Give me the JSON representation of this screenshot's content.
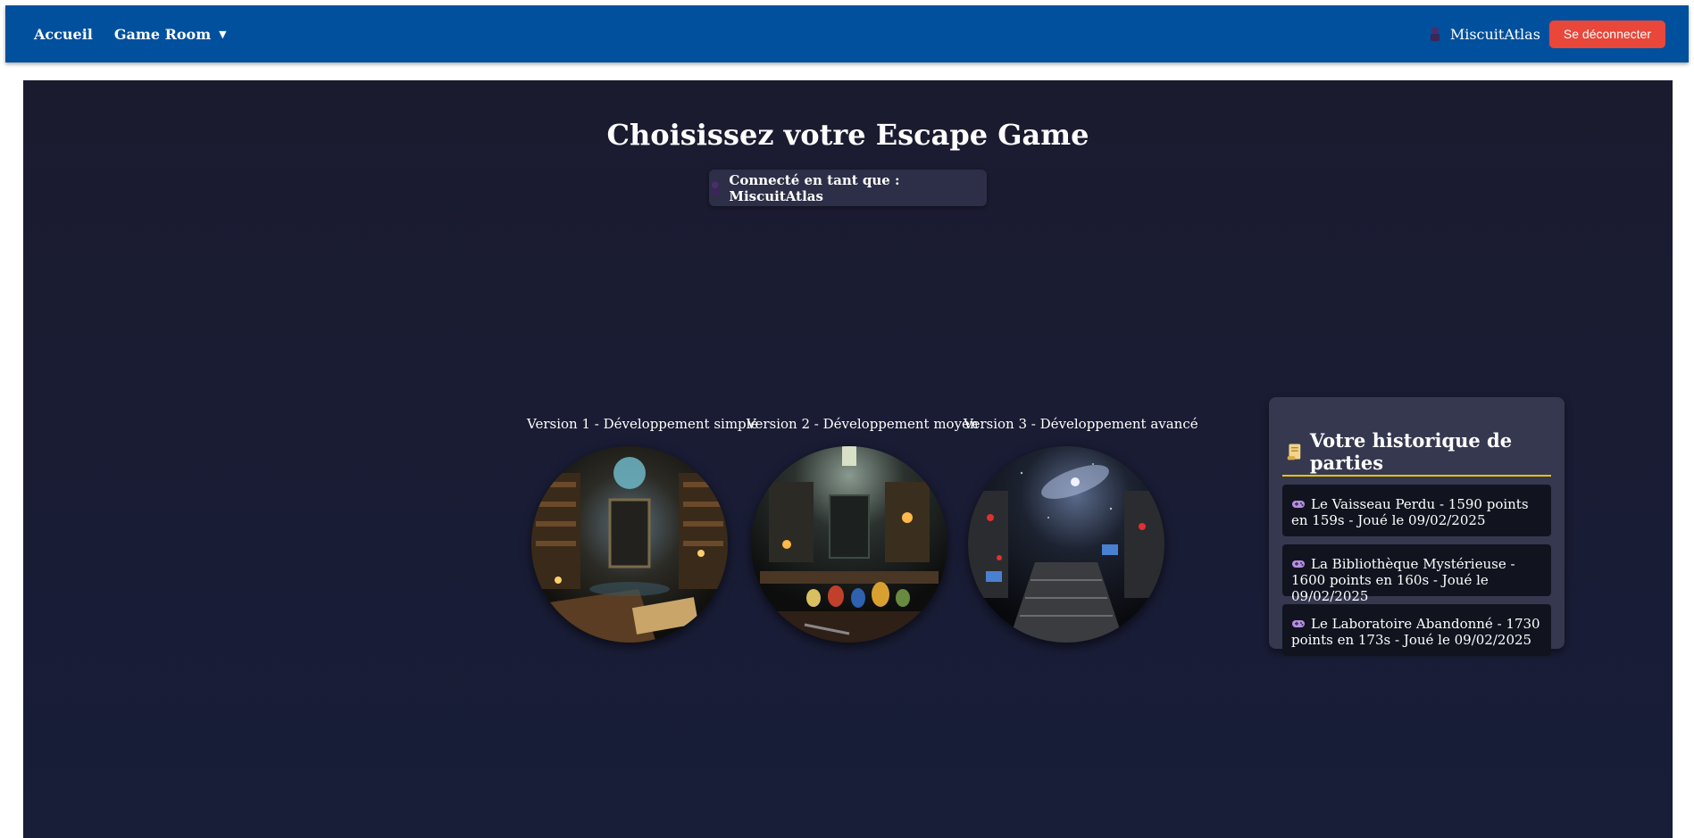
{
  "navbar": {
    "home_label": "Accueil",
    "game_room_label": "Game Room",
    "dropdown_caret": "▼",
    "username": "MiscuitAtlas",
    "logout_label": "Se déconnecter"
  },
  "main": {
    "title": "Choisissez votre Escape Game",
    "connected_as": "Connecté en tant que : MiscuitAtlas"
  },
  "games": [
    {
      "label": "Version 1 - Développement simple",
      "image_icon": "library-scene"
    },
    {
      "label": "Version 2 - Développement moyen",
      "image_icon": "laboratory-scene"
    },
    {
      "label": "Version 3 - Développement avancé",
      "image_icon": "spaceship-scene"
    }
  ],
  "history": {
    "title": "Votre historique de parties",
    "title_icon": "scroll-icon",
    "items": [
      {
        "text": "Le Vaisseau Perdu - 1590 points en 159s - Joué le 09/02/2025",
        "icon": "gamepad-icon"
      },
      {
        "text": "La Bibliothèque Mystérieuse - 1600 points en 160s - Joué le 09/02/2025",
        "icon": "gamepad-icon"
      },
      {
        "text": "Le Laboratoire Abandonné - 1730 points en 173s - Joué le 09/02/2025",
        "icon": "gamepad-icon"
      }
    ]
  },
  "colors": {
    "navbar": "#00509d",
    "logout_button": "#e8473a",
    "background": "#1b1b30",
    "panel": "#35384f",
    "accent_underline": "#e9c400"
  }
}
